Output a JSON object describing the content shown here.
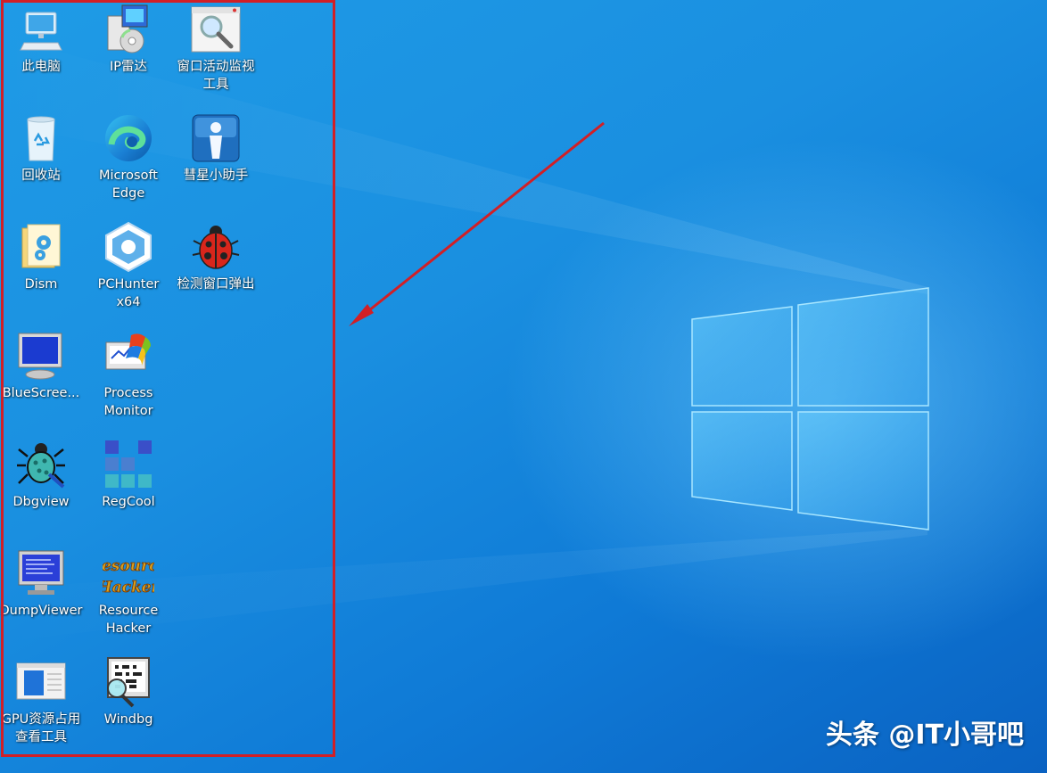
{
  "desktop": {
    "icons": [
      {
        "name": "icon-this-pc",
        "label": "此电脑",
        "icon": "computer-icon"
      },
      {
        "name": "icon-ip-radar",
        "label": "IP雷达",
        "icon": "installer-icon"
      },
      {
        "name": "icon-window-monitor",
        "label": "窗口活动监视\n工具",
        "icon": "magnifier-window-icon"
      },
      {
        "name": "icon-recycle-bin",
        "label": "回收站",
        "icon": "recycle-bin-icon"
      },
      {
        "name": "icon-edge",
        "label": "Microsoft\nEdge",
        "icon": "edge-icon"
      },
      {
        "name": "icon-comet-helper",
        "label": "彗星小助手",
        "icon": "info-person-icon"
      },
      {
        "name": "icon-dism",
        "label": "Dism",
        "icon": "folder-gear-icon"
      },
      {
        "name": "icon-pchunter",
        "label": "PCHunter\nx64",
        "icon": "pchunter-icon"
      },
      {
        "name": "icon-popup-detector",
        "label": "检测窗口弹出",
        "icon": "ladybug-icon"
      },
      {
        "name": "icon-bluescreen",
        "label": "BlueScree...",
        "icon": "blue-monitor-icon"
      },
      {
        "name": "icon-process-monitor",
        "label": "Process\nMonitor",
        "icon": "process-monitor-icon"
      },
      {
        "name": "icon-dbgview",
        "label": "Dbgview",
        "icon": "bug-icon"
      },
      {
        "name": "icon-regcool",
        "label": "RegCool",
        "icon": "grid-squares-icon"
      },
      {
        "name": "icon-dumpviewer",
        "label": "DumpViewer",
        "icon": "bsod-monitor-icon"
      },
      {
        "name": "icon-resource-hacker",
        "label": "Resource\nHacker",
        "icon": "resource-hacker-icon"
      },
      {
        "name": "icon-gpu-usage",
        "label": "GPU资源占用\n查看工具",
        "icon": "window-doc-icon"
      },
      {
        "name": "icon-windbg",
        "label": "Windbg",
        "icon": "windbg-icon"
      }
    ]
  },
  "resource_hacker_logo_text": [
    "Resource",
    "Hacker"
  ],
  "watermark": "头条 @IT小哥吧",
  "colors": {
    "highlight": "#d21f26",
    "arrow": "#d21f26"
  }
}
